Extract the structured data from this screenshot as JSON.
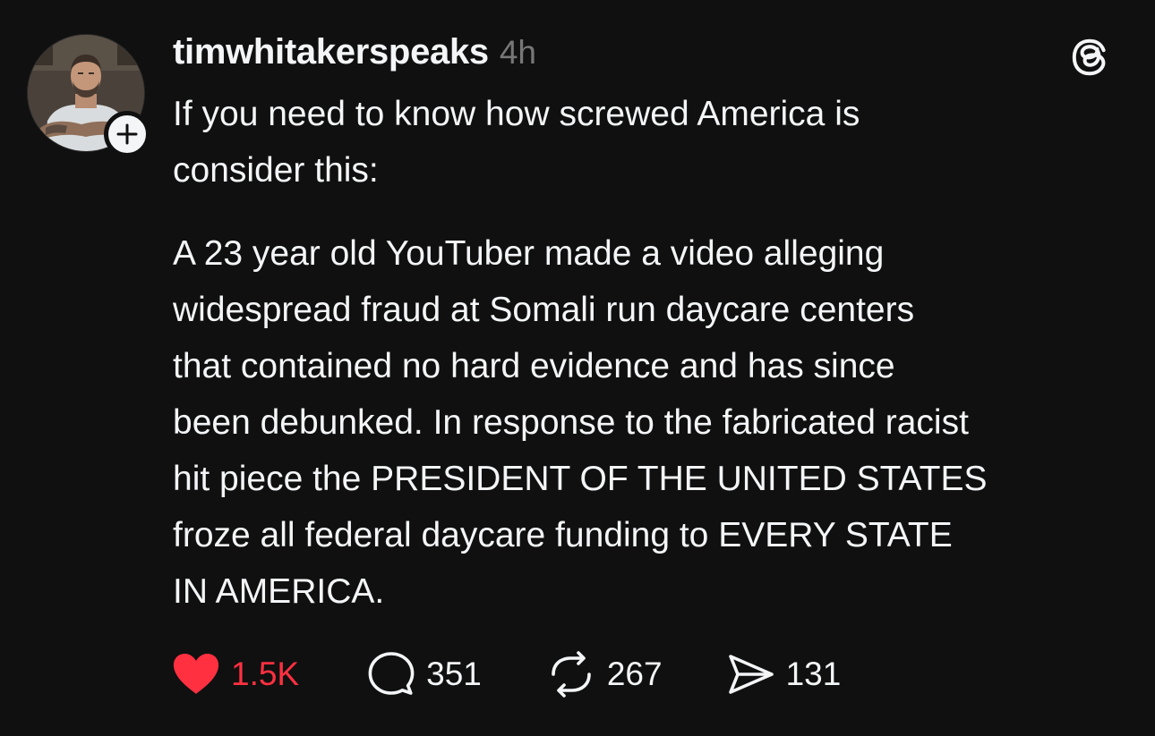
{
  "post": {
    "author": {
      "username": "timwhitakerspeaks",
      "avatar_icon": "profile-photo",
      "follow_icon": "plus-icon"
    },
    "timestamp": "4h",
    "app_icon": "threads-logo-icon",
    "text": {
      "paragraph_1": "If you need to know how screwed America is\nconsider this:",
      "paragraph_2": "A 23 year old YouTuber made a video alleging\nwidespread fraud at Somali run daycare centers\nthat contained no hard evidence and has since\nbeen debunked. In response to the fabricated racist\nhit piece the PRESIDENT OF THE UNITED STATES\nfroze all federal daycare funding to EVERY STATE\nIN AMERICA."
    },
    "actions": {
      "like": {
        "icon": "heart-icon",
        "count": "1.5K",
        "liked": true,
        "color": "#ff3040"
      },
      "reply": {
        "icon": "comment-bubble-icon",
        "count": "351"
      },
      "repost": {
        "icon": "repost-icon",
        "count": "267"
      },
      "share": {
        "icon": "send-icon",
        "count": "131"
      }
    }
  },
  "colors": {
    "background": "#101010",
    "text": "#f3f5f7",
    "muted": "#777777",
    "like": "#ff3040"
  }
}
